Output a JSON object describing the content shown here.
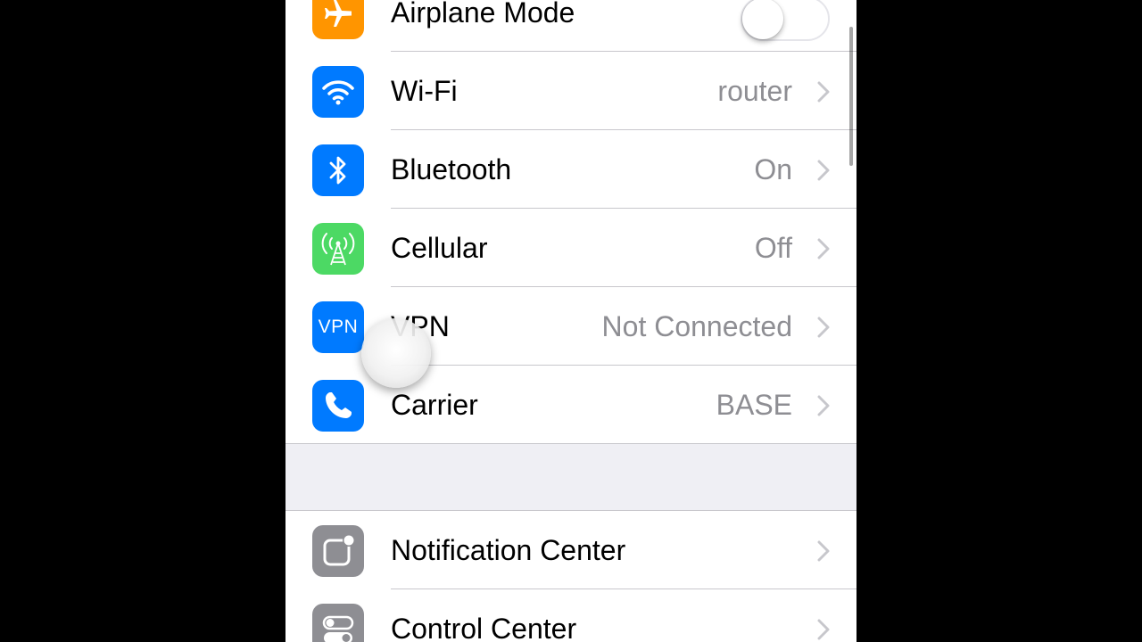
{
  "settings": {
    "rows": [
      {
        "label": "Airplane Mode",
        "icon": "airplane-icon",
        "color": "#ff9500",
        "toggle": false
      },
      {
        "label": "Wi-Fi",
        "icon": "wifi-icon",
        "color": "#007aff",
        "value": "router"
      },
      {
        "label": "Bluetooth",
        "icon": "bluetooth-icon",
        "color": "#007aff",
        "value": "On"
      },
      {
        "label": "Cellular",
        "icon": "cellular-icon",
        "color": "#4cd964",
        "value": "Off"
      },
      {
        "label": "VPN",
        "icon": "vpn-icon",
        "icon_text": "VPN",
        "color": "#007aff",
        "value": "Not Connected"
      },
      {
        "label": "Carrier",
        "icon": "phone-icon",
        "color": "#007aff",
        "value": "BASE"
      }
    ],
    "rows2": [
      {
        "label": "Notification Center",
        "icon": "notification-center-icon",
        "color": "#8e8e93"
      },
      {
        "label": "Control Center",
        "icon": "control-center-icon",
        "color": "#8e8e93"
      }
    ]
  }
}
